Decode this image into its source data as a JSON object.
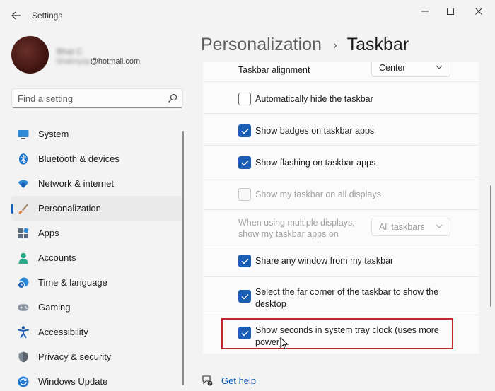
{
  "window": {
    "title": "Settings"
  },
  "user": {
    "name": "Bhat C",
    "email_suffix": "@hotmail.com",
    "email_prefix": "bhatmysp"
  },
  "search": {
    "placeholder": "Find a setting"
  },
  "sidebar": {
    "items": [
      {
        "label": "System",
        "icon": "monitor-icon"
      },
      {
        "label": "Bluetooth & devices",
        "icon": "bluetooth-icon"
      },
      {
        "label": "Network & internet",
        "icon": "wifi-icon"
      },
      {
        "label": "Personalization",
        "icon": "brush-icon",
        "active": true
      },
      {
        "label": "Apps",
        "icon": "apps-icon"
      },
      {
        "label": "Accounts",
        "icon": "person-icon"
      },
      {
        "label": "Time & language",
        "icon": "clock-globe-icon"
      },
      {
        "label": "Gaming",
        "icon": "gamepad-icon"
      },
      {
        "label": "Accessibility",
        "icon": "accessibility-icon"
      },
      {
        "label": "Privacy & security",
        "icon": "shield-icon"
      },
      {
        "label": "Windows Update",
        "icon": "update-icon"
      }
    ]
  },
  "breadcrumb": {
    "parent": "Personalization",
    "current": "Taskbar"
  },
  "settings": {
    "alignment": {
      "label": "Taskbar alignment",
      "value": "Center"
    },
    "auto_hide": {
      "label": "Automatically hide the taskbar",
      "checked": false
    },
    "badges": {
      "label": "Show badges on taskbar apps",
      "checked": true
    },
    "flashing": {
      "label": "Show flashing on taskbar apps",
      "checked": true
    },
    "all_displays": {
      "label": "Show my taskbar on all displays",
      "checked": false,
      "disabled": true
    },
    "multi_display": {
      "label_line1": "When using multiple displays,",
      "label_line2": "show my taskbar apps on",
      "value": "All taskbars",
      "disabled": true
    },
    "share_window": {
      "label": "Share any window from my taskbar",
      "checked": true
    },
    "far_corner": {
      "label_line1": "Select the far corner of the taskbar to show the",
      "label_line2": "desktop",
      "checked": true
    },
    "seconds": {
      "label_line1": "Show seconds in system tray clock (uses more",
      "label_line2": "power)",
      "checked": true
    }
  },
  "help": {
    "label": "Get help"
  },
  "colors": {
    "accent": "#1a5fb4",
    "highlight": "#c4262e"
  }
}
